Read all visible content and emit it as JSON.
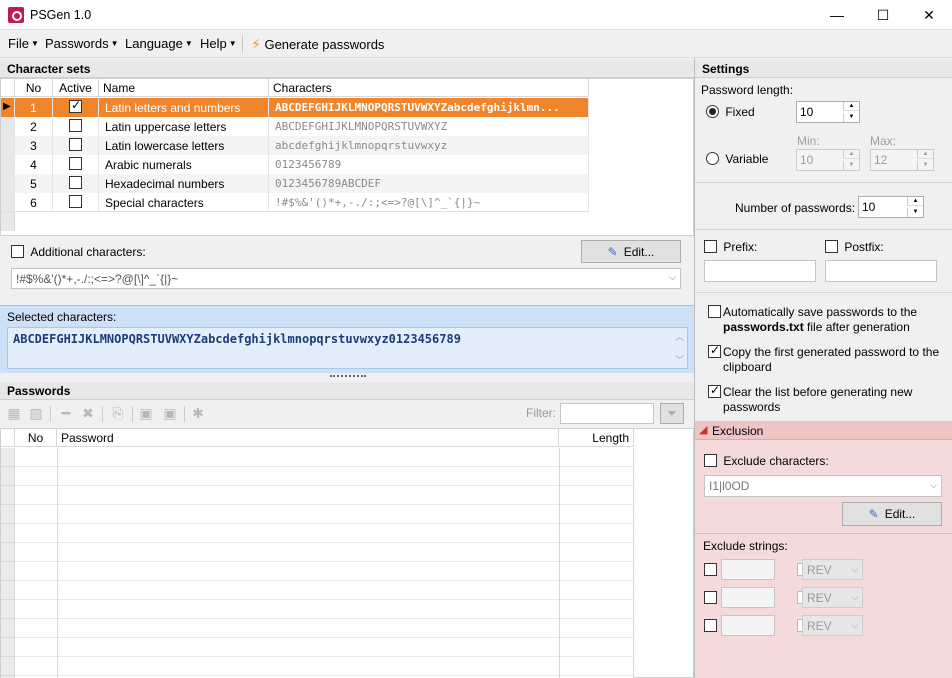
{
  "window": {
    "title": "PSGen 1.0",
    "minimize": "—",
    "maximize": "☐",
    "close": "✕"
  },
  "menu": {
    "file": "File",
    "passwords": "Passwords",
    "language": "Language",
    "help": "Help",
    "generate": "Generate passwords"
  },
  "charsets": {
    "header": "Character sets",
    "columns": {
      "no": "No",
      "active": "Active",
      "name": "Name",
      "characters": "Characters"
    },
    "rows": [
      {
        "no": "1",
        "active": true,
        "name": "Latin letters and numbers",
        "chars": "ABCDEFGHIJKLMNOPQRSTUVWXYZabcdefghijklmn..."
      },
      {
        "no": "2",
        "active": false,
        "name": "Latin uppercase letters",
        "chars": "ABCDEFGHIJKLMNOPQRSTUVWXYZ"
      },
      {
        "no": "3",
        "active": false,
        "name": "Latin lowercase letters",
        "chars": "abcdefghijklmnopqrstuvwxyz"
      },
      {
        "no": "4",
        "active": false,
        "name": "Arabic numerals",
        "chars": "0123456789"
      },
      {
        "no": "5",
        "active": false,
        "name": "Hexadecimal numbers",
        "chars": "0123456789ABCDEF"
      },
      {
        "no": "6",
        "active": false,
        "name": "Special characters",
        "chars": "!#$%&'()*+,-./:;<=>?@[\\]^_`{|}~"
      }
    ]
  },
  "additional": {
    "label": "Additional characters:",
    "edit": "Edit...",
    "value": "!#$%&'()*+,-./:;<=>?@[\\]^_`{|}~"
  },
  "selected": {
    "label": "Selected characters:",
    "value": "ABCDEFGHIJKLMNOPQRSTUVWXYZabcdefghijklmnopqrstuvwxyz0123456789"
  },
  "passwords": {
    "header": "Passwords",
    "filter_label": "Filter:",
    "columns": {
      "no": "No",
      "password": "Password",
      "length": "Length"
    }
  },
  "settings": {
    "header": "Settings",
    "length_label": "Password length:",
    "fixed": "Fixed",
    "fixed_value": "10",
    "variable": "Variable",
    "min_label": "Min:",
    "min_value": "10",
    "max_label": "Max:",
    "max_value": "12",
    "count_label": "Number of passwords:",
    "count_value": "10",
    "prefix": "Prefix:",
    "postfix": "Postfix:",
    "autosave_1": "Automatically save passwords to the",
    "autosave_bold": "passwords.txt",
    "autosave_2": " file after generation",
    "copy_first": "Copy the first generated password to the clipboard",
    "clear_list": "Clear the list before generating new passwords"
  },
  "exclusion": {
    "header": "Exclusion",
    "exclude_chars": "Exclude characters:",
    "exclude_chars_value": "I1|l0OD",
    "edit": "Edit...",
    "exclude_strings": "Exclude strings:",
    "rev": "REV"
  }
}
